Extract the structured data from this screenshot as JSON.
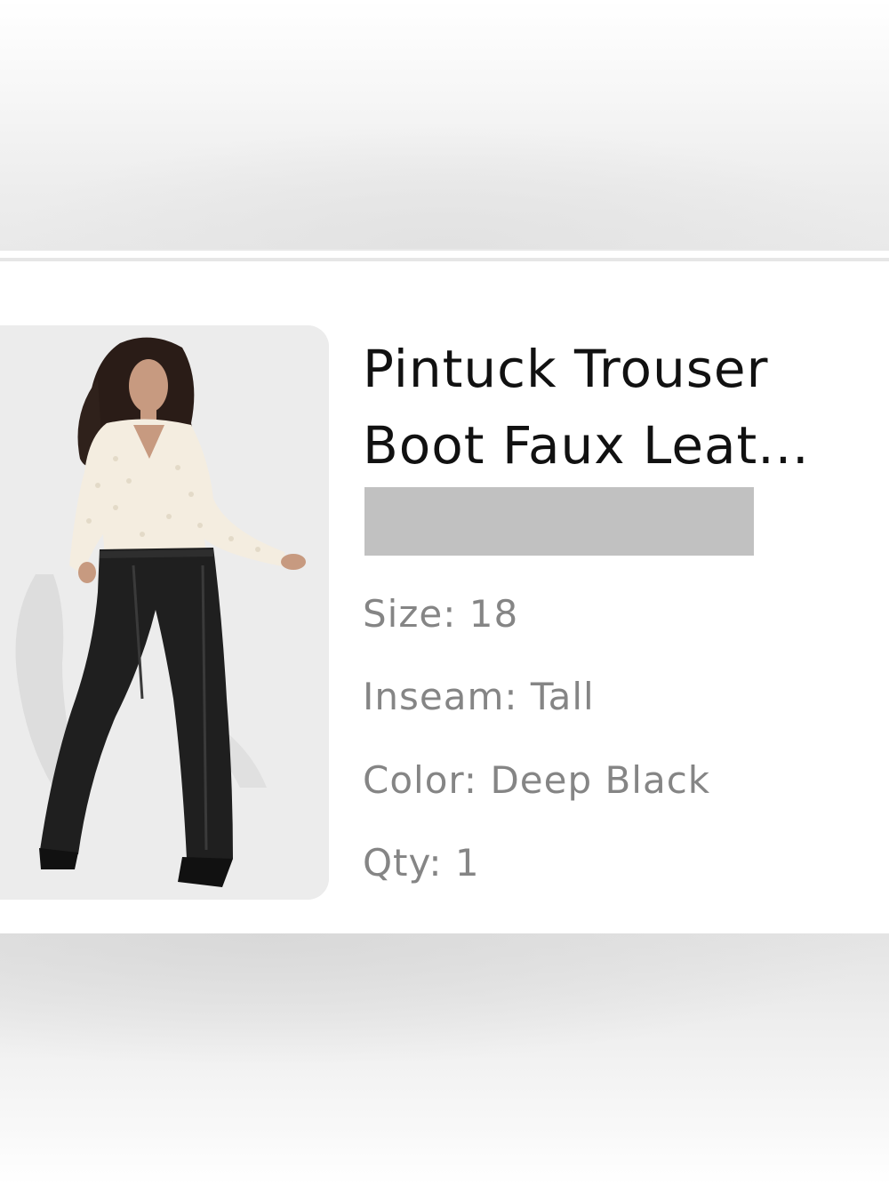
{
  "product": {
    "title_line1": "Pintuck Trouser",
    "title_line2": "Boot Faux Leat...",
    "image_alt": "Model wearing black faux leather boot-cut trousers with a cream lace button-up blouse",
    "attributes": {
      "size_label": "Size:",
      "size_value": "18",
      "inseam_label": "Inseam:",
      "inseam_value": "Tall",
      "color_label": "Color:",
      "color_value": "Deep Black",
      "qty_label": "Qty:",
      "qty_value": "1"
    }
  },
  "colors": {
    "title": "#111111",
    "attribute_text": "#858585",
    "price_redaction": "#c1c1c1",
    "image_background": "#ececec"
  }
}
